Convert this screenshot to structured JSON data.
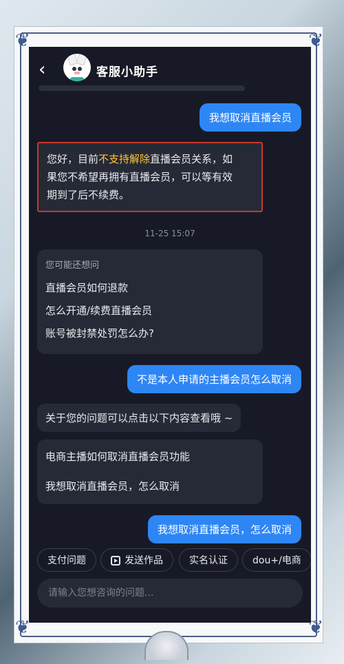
{
  "header": {
    "back_icon": "‹",
    "title": "客服小助手"
  },
  "messages": {
    "user_1": "我想取消直播会员",
    "bot_1": {
      "prefix": "您好，目前",
      "highlight": "不支持解除",
      "line1_suffix": "直播会员关系，如",
      "line2": "果您不希望再拥有直播会员，可以等有效",
      "line3": "期到了后不续费。"
    },
    "timestamp": "11-25 15:07",
    "suggestions": {
      "heading": "您可能还想问",
      "items": [
        "直播会员如何退款",
        "怎么开通/续费直播会员",
        "账号被封禁处罚怎么办?"
      ]
    },
    "user_2": "不是本人申请的主播会员怎么取消",
    "bot_2": "关于您的问题可以点击以下内容查看哦 ~",
    "links": [
      "电商主播如何取消直播会员功能",
      "我想取消直播会员，怎么取消"
    ],
    "user_3": "我想取消直播会员，怎么取消"
  },
  "quick_actions": [
    "支付问题",
    "发送作品",
    "实名认证",
    "dou+/电商"
  ],
  "input": {
    "placeholder": "请输入您想咨询的问题..."
  },
  "colors": {
    "user_bubble": "#2e86f5",
    "bot_bubble": "#262a36",
    "highlight": "#ffc533",
    "outline": "#c8382d",
    "background": "#171a26"
  }
}
